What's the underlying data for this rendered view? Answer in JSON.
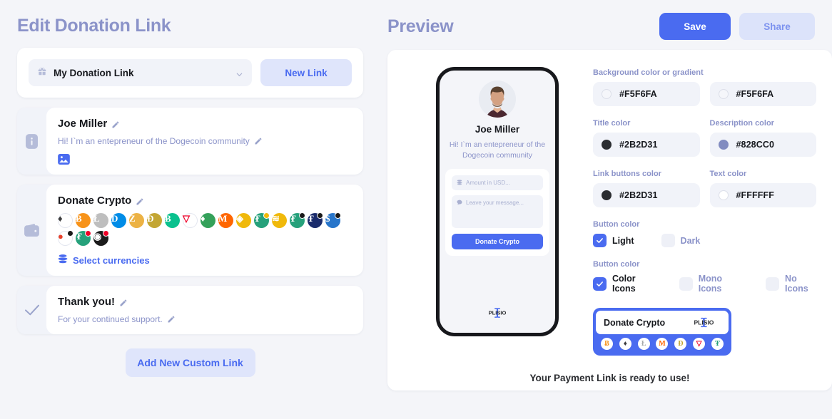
{
  "left": {
    "title": "Edit Donation Link",
    "selector": {
      "icon": "gift-icon",
      "value": "My Donation Link",
      "chevron": "chevron-down-icon"
    },
    "new_link_label": "New Link",
    "add_custom_label": "Add New Custom Link",
    "blocks": [
      {
        "gutter_icon": "info-icon",
        "title": "Joe Miller",
        "subtitle": "Hi! I`m an entepreneur of the Dogecoin community",
        "image_icon": "image-upload-icon"
      },
      {
        "gutter_icon": "wallet-icon",
        "title": "Donate Crypto",
        "select_currencies_label": "Select currencies",
        "select_currencies_icon": "coins-stack-icon"
      },
      {
        "gutter_icon": "check-icon",
        "title": "Thank you!",
        "subtitle": "For your continued support."
      }
    ],
    "coins": [
      {
        "name": "ETH",
        "sym": "♦",
        "bg": "#ffffff",
        "fg": "#3c3c3d",
        "badge": ""
      },
      {
        "name": "BTC",
        "sym": "Ƀ",
        "bg": "#f7931a",
        "fg": "#ffffff",
        "badge": ""
      },
      {
        "name": "LTC",
        "sym": "Ł",
        "bg": "#bebebe",
        "fg": "#ffffff",
        "badge": ""
      },
      {
        "name": "DASH",
        "sym": "D",
        "bg": "#008ce7",
        "fg": "#ffffff",
        "badge": ""
      },
      {
        "name": "ZEC",
        "sym": "Z",
        "bg": "#ecb244",
        "fg": "#ffffff",
        "badge": ""
      },
      {
        "name": "DOGE",
        "sym": "Ð",
        "bg": "#c3a634",
        "fg": "#ffffff",
        "badge": ""
      },
      {
        "name": "BCH",
        "sym": "Ƀ",
        "bg": "#0ac18e",
        "fg": "#ffffff",
        "badge": ""
      },
      {
        "name": "TRX",
        "sym": "▽",
        "bg": "#ffffff",
        "fg": "#ef0027",
        "badge": ""
      },
      {
        "name": "ETC",
        "sym": "♦",
        "bg": "#34a15a",
        "fg": "#ffffff",
        "badge": ""
      },
      {
        "name": "XMR",
        "sym": "M",
        "bg": "#ff6600",
        "fg": "#ffffff",
        "badge": ""
      },
      {
        "name": "BNB",
        "sym": "◈",
        "bg": "#f0b90b",
        "fg": "#ffffff",
        "badge": ""
      },
      {
        "name": "USDT-BSC",
        "sym": "₮",
        "bg": "#26a17b",
        "fg": "#ffffff",
        "badge": "#f0b90b"
      },
      {
        "name": "USDT-ERC",
        "sym": "≋",
        "bg": "#f0b90b",
        "fg": "#ffffff",
        "badge": ""
      },
      {
        "name": "USDT",
        "sym": "₮",
        "bg": "#26a17b",
        "fg": "#ffffff",
        "badge": "#1b1b1b"
      },
      {
        "name": "TUSD",
        "sym": "Ŧ",
        "bg": "#1a2b6b",
        "fg": "#ffffff",
        "badge": "#1b1b1b"
      },
      {
        "name": "USDC",
        "sym": "$",
        "bg": "#2775ca",
        "fg": "#ffffff",
        "badge": "#1b1b1b"
      },
      {
        "name": "SHIB",
        "sym": "●",
        "bg": "#ffffff",
        "fg": "#e8402a",
        "badge": "#1b1b1b"
      },
      {
        "name": "USDT-TRC",
        "sym": "₮",
        "bg": "#26a17b",
        "fg": "#ffffff",
        "badge": "#ef0027"
      },
      {
        "name": "CRO",
        "sym": "◉",
        "bg": "#1b1b1b",
        "fg": "#ffffff",
        "badge": "#ef0027"
      }
    ]
  },
  "right": {
    "title": "Preview",
    "save_label": "Save",
    "share_label": "Share",
    "footer_note": "Your Payment Link is ready to use!",
    "phone": {
      "avatar": "user-avatar",
      "name": "Joe Miller",
      "description": "Hi! I`m an entepreneur of the Dogecoin community",
      "amount_placeholder": "Amount in USD...",
      "amount_icon": "coins-stack-icon",
      "message_placeholder": "Leave your message...",
      "message_icon": "chat-bubble-icon",
      "donate_label": "Donate Crypto",
      "brand": "PLISIO"
    },
    "settings": {
      "background_label": "Background color or gradient",
      "background_from": {
        "value": "#F5F6FA",
        "swatch": "#F5F6FA"
      },
      "background_to": {
        "value": "#F5F6FA",
        "swatch": "#F5F6FA"
      },
      "title_color_label": "Title color",
      "title_color": {
        "value": "#2B2D31",
        "swatch": "#2B2D31"
      },
      "description_color_label": "Description color",
      "description_color": {
        "value": "#828CC0",
        "swatch": "#828CC0"
      },
      "link_buttons_label": "Link buttons color",
      "link_buttons_color": {
        "value": "#2B2D31",
        "swatch": "#2B2D31"
      },
      "text_color_label": "Text color",
      "text_color": {
        "value": "#FFFFFF",
        "swatch": "#FFFFFF"
      },
      "button_color_label_1": "Button color",
      "theme_options": [
        {
          "label": "Light",
          "checked": true
        },
        {
          "label": "Dark",
          "checked": false
        }
      ],
      "button_color_label_2": "Button color",
      "icon_options": [
        {
          "label": "Color Icons",
          "checked": true
        },
        {
          "label": "Mono Icons",
          "checked": false
        },
        {
          "label": "No Icons",
          "checked": false
        }
      ]
    },
    "widget": {
      "label": "Donate Crypto",
      "brand": "PLISIO",
      "coins": [
        {
          "name": "BTC",
          "sym": "Ƀ",
          "fg": "#f7931a"
        },
        {
          "name": "ETH",
          "sym": "♦",
          "fg": "#3c3c3d"
        },
        {
          "name": "LTC",
          "sym": "Ł",
          "fg": "#a6a9aa"
        },
        {
          "name": "XMR",
          "sym": "M",
          "fg": "#ff6600"
        },
        {
          "name": "DOGE",
          "sym": "Ð",
          "fg": "#c3a634"
        },
        {
          "name": "TRX",
          "sym": "▽",
          "fg": "#ef0027"
        },
        {
          "name": "USDT",
          "sym": "₮",
          "fg": "#26a17b"
        }
      ]
    },
    "accent": "#4A6BF0"
  }
}
